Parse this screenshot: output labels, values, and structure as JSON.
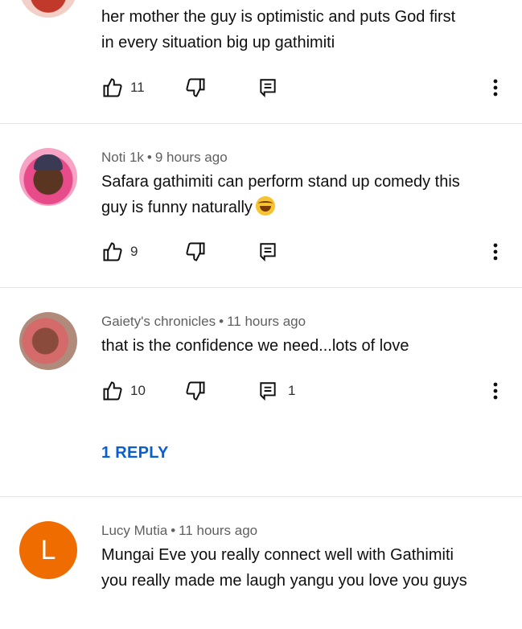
{
  "comments": [
    {
      "text_lines": [
        "her mother the guy is  optimistic  and puts God first",
        "in every situation big up gathimiti"
      ],
      "likes": "11",
      "replies": ""
    },
    {
      "author": "Noti 1k",
      "time": "9 hours ago",
      "text_lines": [
        "Safara gathimiti can perform stand up comedy this",
        "guy is funny naturally"
      ],
      "emoji": "rolling-on-floor-laughing",
      "likes": "9",
      "replies": ""
    },
    {
      "author": "Gaiety's chronicles",
      "time": "11 hours ago",
      "text_lines": [
        "that is the confidence we need...lots of love"
      ],
      "likes": "10",
      "replies": "1",
      "reply_link": "1 REPLY"
    },
    {
      "author": "Lucy Mutia",
      "time": "11 hours ago",
      "avatar_letter": "L",
      "avatar_color": "#ef6c00",
      "text_lines": [
        "Mungai Eve you really connect well with Gathimiti",
        "you really made me laugh yangu you love you guys"
      ]
    }
  ],
  "separator": "•",
  "colors": {
    "link": "#065fd4",
    "meta": "#606060",
    "divider": "#e5e5e5"
  }
}
